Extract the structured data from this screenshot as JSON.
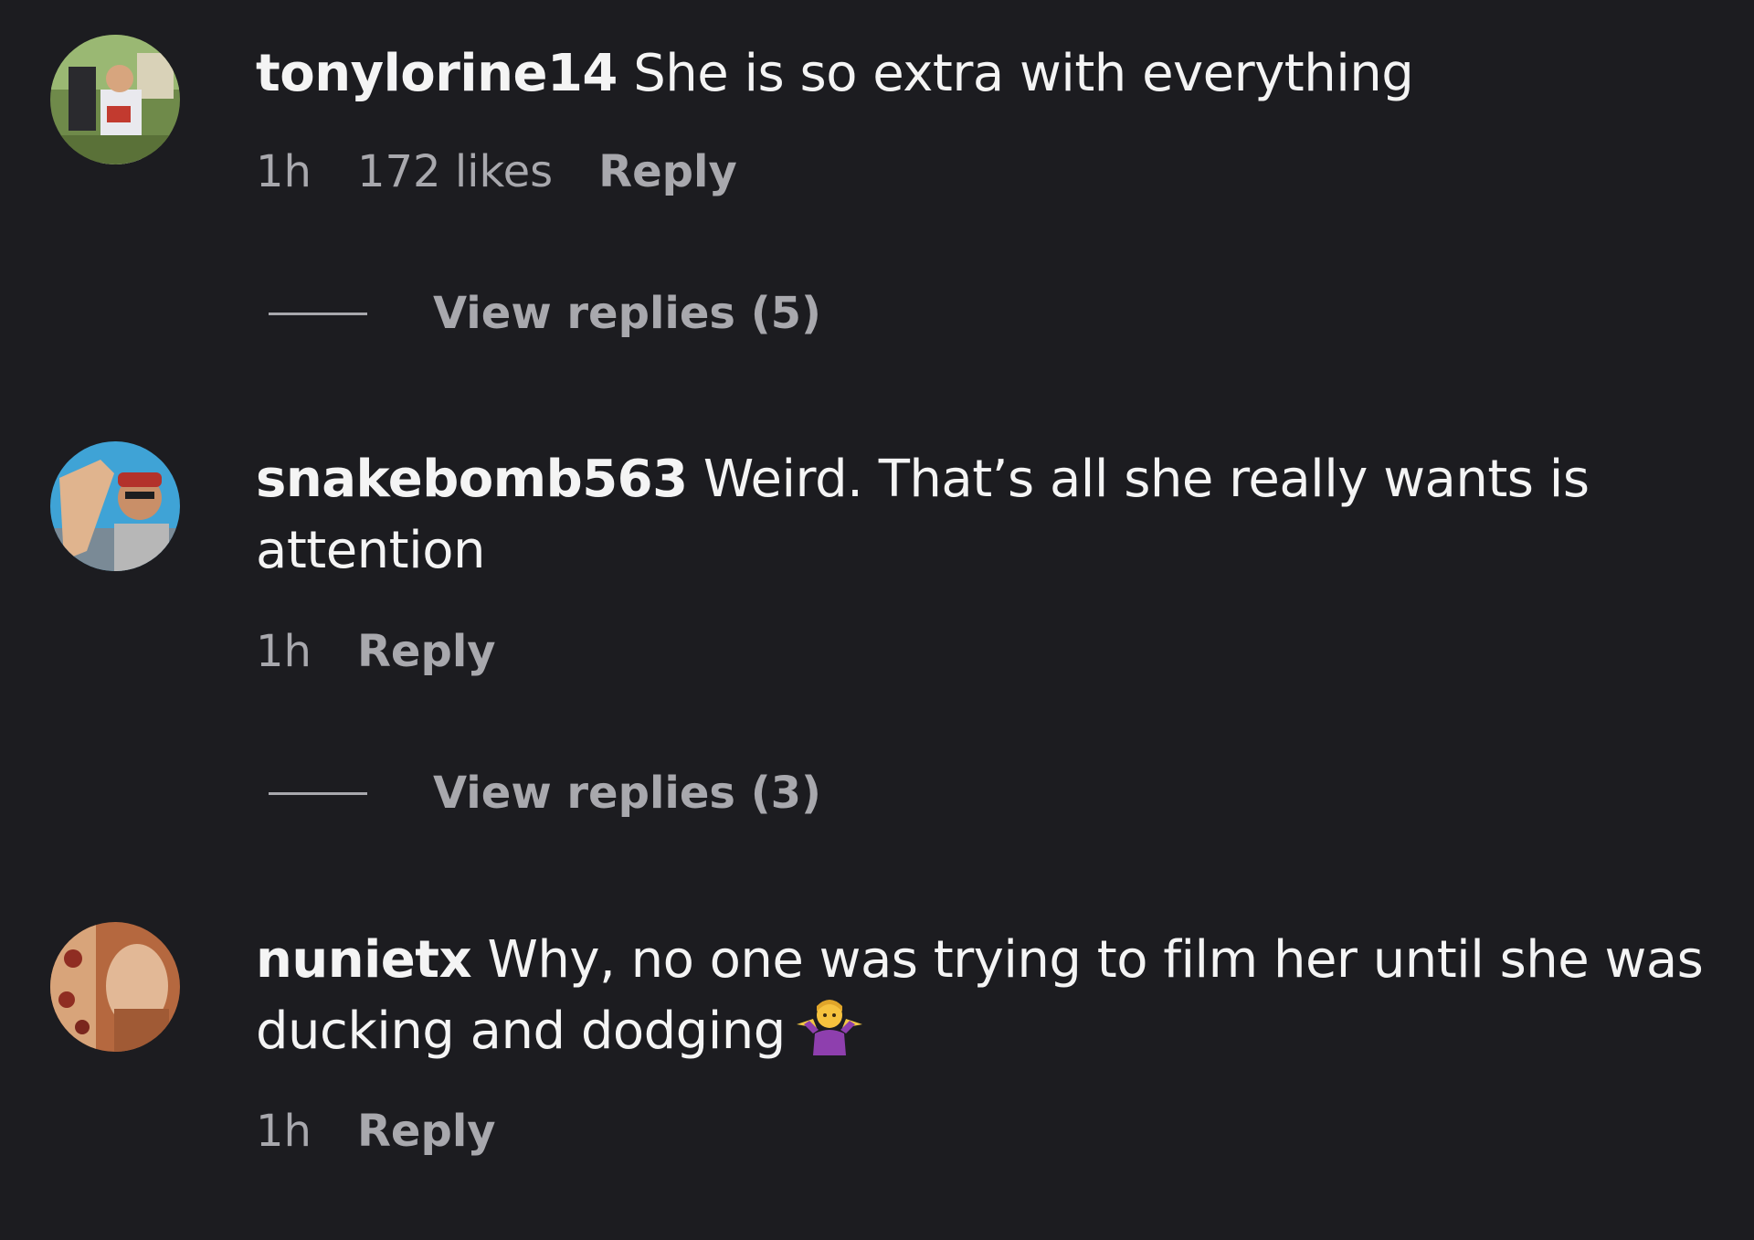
{
  "comments": [
    {
      "username": "tonylorine14",
      "text": "She is so extra with everything",
      "time": "1h",
      "likes": "172 likes",
      "reply_label": "Reply",
      "view_replies": "View replies (5)"
    },
    {
      "username": "snakebomb563",
      "text": "Weird. That’s all she really wants is attention",
      "time": "1h",
      "reply_label": "Reply",
      "view_replies": "View replies (3)"
    },
    {
      "username": "nunietx",
      "text": "Why, no one was trying to film her until she was ducking and dodging",
      "emoji": "woman-shrugging-emoji",
      "time": "1h",
      "reply_label": "Reply"
    }
  ],
  "colors": {
    "background": "#1c1c20",
    "primary_text": "#f4f4f4",
    "secondary_text": "#a8a8ad"
  }
}
